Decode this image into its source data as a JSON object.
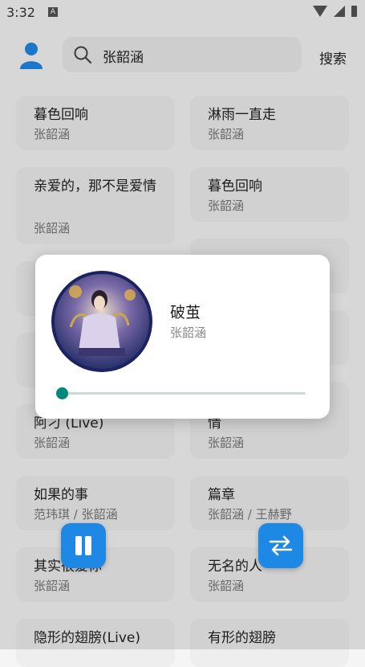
{
  "status_bar": {
    "time": "3:32",
    "notification_badge": "A"
  },
  "header": {
    "search_query": "张韶涵",
    "search_button": "搜索"
  },
  "songs": [
    {
      "title": "暮色回响",
      "artist": "张韶涵"
    },
    {
      "title": "淋雨一直走",
      "artist": "张韶涵"
    },
    {
      "title": "亲爱的，那不是爱情",
      "artist": "张韶涵"
    },
    {
      "title": "暮色回响",
      "artist": "张韶涵"
    },
    {
      "title": "阿刁 (Live)",
      "artist": "张韶涵"
    },
    {
      "title": "情",
      "artist": "张韶涵"
    },
    {
      "title": "如果的事",
      "artist": "范玮琪 / 张韶涵"
    },
    {
      "title": "篇章",
      "artist": "张韶涵 / 王赫野"
    },
    {
      "title": "其实很爱你",
      "artist": "张韶涵"
    },
    {
      "title": "无名的人",
      "artist": "张韶涵"
    },
    {
      "title": "隐形的翅膀(Live)",
      "artist": ""
    },
    {
      "title": "有形的翅膀",
      "artist": ""
    }
  ],
  "player": {
    "title": "破茧",
    "artist": "张韶涵",
    "progress": 0.0,
    "cover_icon": "album-cover"
  },
  "fabs": {
    "play_pause_icon": "pause-icon",
    "switch_icon": "swap-icon"
  },
  "colors": {
    "accent": "#1e88e5",
    "progress": "#00897b"
  }
}
